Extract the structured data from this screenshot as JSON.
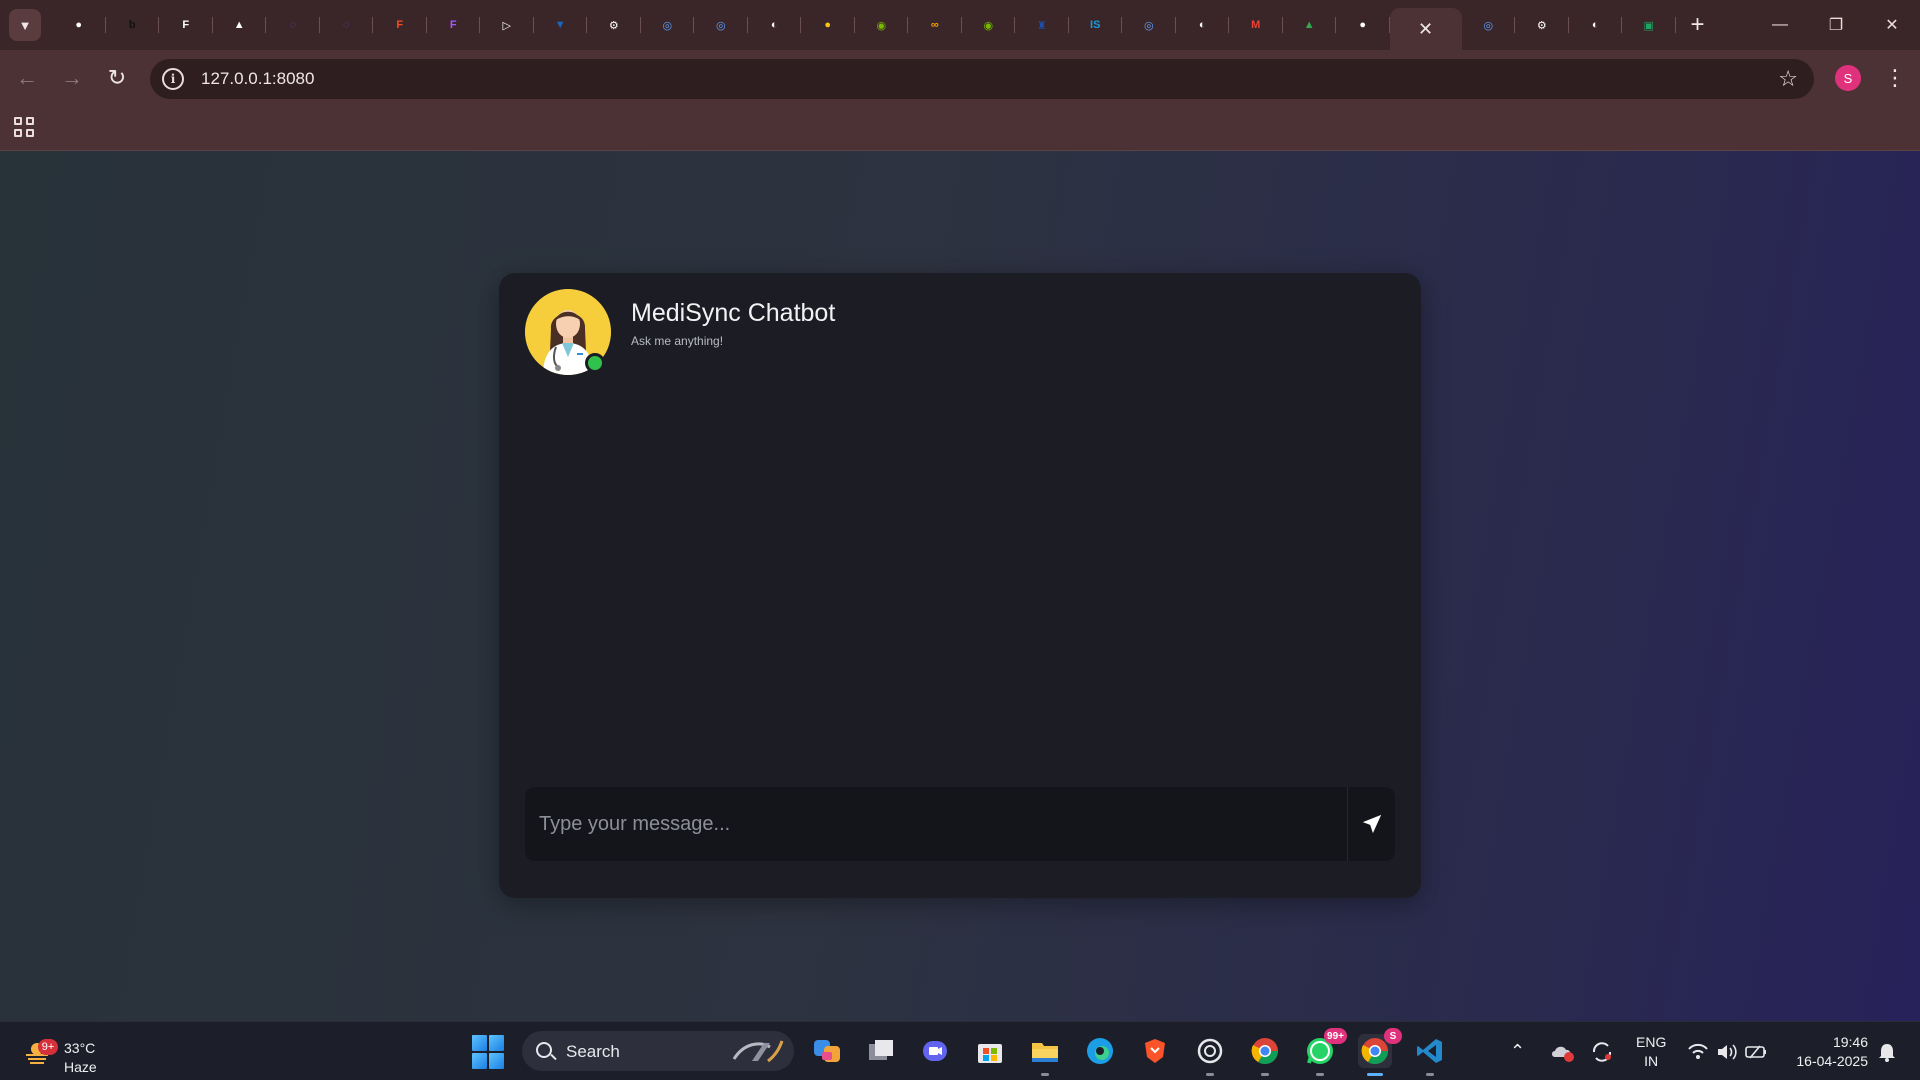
{
  "browser": {
    "tabs": [
      {
        "icon": "github-icon",
        "color": "#ffffff",
        "glyph": "●"
      },
      {
        "icon": "bold-b-icon",
        "color": "#111111",
        "glyph": "b"
      },
      {
        "icon": "puzzle-icon",
        "color": "#ffffff",
        "glyph": "F"
      },
      {
        "icon": "box-icon",
        "color": "#ffffff",
        "glyph": "▲"
      },
      {
        "icon": "faded-icon",
        "color": "#4b4fa0",
        "glyph": "◌"
      },
      {
        "icon": "faded-icon",
        "color": "#4b4fa0",
        "glyph": "◌"
      },
      {
        "icon": "figma-icon",
        "color": "#f24e1e",
        "glyph": "F"
      },
      {
        "icon": "figma-icon",
        "color": "#a259ff",
        "glyph": "F"
      },
      {
        "icon": "play-icon",
        "color": "#ffffff",
        "glyph": "▷"
      },
      {
        "icon": "vuetify-icon",
        "color": "#1867c0",
        "glyph": "▼"
      },
      {
        "icon": "openai-icon",
        "color": "#ffffff",
        "glyph": "⚙"
      },
      {
        "icon": "globe-blue-icon",
        "color": "#5aa0ff",
        "glyph": "◎"
      },
      {
        "icon": "globe-blue-icon",
        "color": "#5aa0ff",
        "glyph": "◎"
      },
      {
        "icon": "globe-icon",
        "color": "#ffffff",
        "glyph": "◐"
      },
      {
        "icon": "ghost-icon",
        "color": "#f5c518",
        "glyph": "●"
      },
      {
        "icon": "nvidia-icon",
        "color": "#76b900",
        "glyph": "◉"
      },
      {
        "icon": "infinity-icon",
        "color": "#f59f00",
        "glyph": "∞"
      },
      {
        "icon": "nvidia-icon",
        "color": "#76b900",
        "glyph": "◉"
      },
      {
        "icon": "crest-icon",
        "color": "#1b4fb3",
        "glyph": "♜"
      },
      {
        "icon": "is-icon",
        "color": "#1a9be0",
        "glyph": "IS"
      },
      {
        "icon": "globe-blue-icon",
        "color": "#5aa0ff",
        "glyph": "◎"
      },
      {
        "icon": "globe-icon",
        "color": "#ffffff",
        "glyph": "◐"
      },
      {
        "icon": "gmail-icon",
        "color": "#ea4335",
        "glyph": "M"
      },
      {
        "icon": "drive-icon",
        "color": "#34a853",
        "glyph": "▲"
      },
      {
        "icon": "github-icon",
        "color": "#ffffff",
        "glyph": "●"
      }
    ],
    "active_tab_close": "✕",
    "tabs_after": [
      {
        "icon": "globe-blue-icon",
        "color": "#5aa0ff",
        "glyph": "◎"
      },
      {
        "icon": "openai-icon",
        "color": "#ffffff",
        "glyph": "⚙"
      },
      {
        "icon": "globe-icon",
        "color": "#ffffff",
        "glyph": "◐"
      },
      {
        "icon": "sheet-icon",
        "color": "#1fa463",
        "glyph": "▣"
      }
    ],
    "new_tab": "+",
    "url": "127.0.0.1:8080",
    "profile_initial": "S",
    "window_controls": {
      "minimize": "—",
      "restore": "❐",
      "close": "✕"
    }
  },
  "chat": {
    "title": "MediSync Chatbot",
    "subtitle": "Ask me anything!",
    "input_placeholder": "Type your message..."
  },
  "taskbar": {
    "weather_badge": "9+",
    "temperature": "33°C",
    "condition": "Haze",
    "search_label": "Search",
    "whatsapp_badge": "99+",
    "chrome_profile_badge": "S",
    "language": "ENG",
    "region": "IN",
    "time": "19:46",
    "date": "16-04-2025"
  }
}
